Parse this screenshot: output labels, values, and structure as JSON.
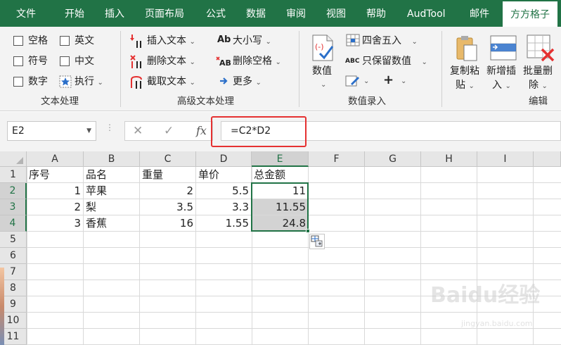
{
  "tabs": [
    {
      "label": "文件",
      "active": false
    },
    {
      "label": "开始",
      "active": false
    },
    {
      "label": "插入",
      "active": false
    },
    {
      "label": "页面布局",
      "active": false
    },
    {
      "label": "公式",
      "active": false
    },
    {
      "label": "数据",
      "active": false
    },
    {
      "label": "审阅",
      "active": false
    },
    {
      "label": "视图",
      "active": false
    },
    {
      "label": "帮助",
      "active": false
    },
    {
      "label": "AudTool",
      "active": false
    },
    {
      "label": "邮件",
      "active": false
    },
    {
      "label": "方方格子",
      "active": true
    }
  ],
  "ribbon": {
    "text_group": {
      "label": "文本处理",
      "checkboxes": [
        "空格",
        "英文",
        "符号",
        "中文",
        "数字"
      ],
      "execute_label": "执行"
    },
    "advanced_group": {
      "label": "高级文本处理",
      "insert_text": "插入文本",
      "delete_text": "删除文本",
      "extract_text": "截取文本",
      "case": "大小写",
      "delete_spaces": "删除空格",
      "more": "更多"
    },
    "number_group": {
      "label": "数值录入",
      "number": "数值",
      "round": "四舍五入",
      "keep_values": "只保留数值",
      "plus": "+"
    },
    "edit_group": {
      "label": "编辑",
      "copy_paste": [
        "复制粘",
        "贴"
      ],
      "add_insert": [
        "新增插",
        "入"
      ],
      "batch_delete": [
        "批量删",
        "除"
      ]
    }
  },
  "formula_bar": {
    "name_box": "E2",
    "formula": "=C2*D2",
    "fx": "fx"
  },
  "sheet": {
    "columns": [
      "A",
      "B",
      "C",
      "D",
      "E",
      "F",
      "G",
      "H",
      "I"
    ],
    "selected_column": "E",
    "rows": [
      "1",
      "2",
      "3",
      "4",
      "5",
      "6",
      "7",
      "8",
      "9",
      "10",
      "11"
    ],
    "selected_rows": [
      "2",
      "3",
      "4"
    ],
    "cells": [
      [
        "序号",
        "品名",
        "重量",
        "单价",
        "总金额"
      ],
      [
        "1",
        "苹果",
        "2",
        "5.5",
        "11"
      ],
      [
        "2",
        "梨",
        "3.5",
        "3.3",
        "11.55"
      ],
      [
        "3",
        "香蕉",
        "16",
        "1.55",
        "24.8"
      ]
    ]
  },
  "watermark": {
    "text": "Baidu经验",
    "sub": "jingyan.baidu.com"
  },
  "colors": {
    "accent": "#217346",
    "highlight": "#e53131",
    "selection": "#d3d3d3"
  }
}
